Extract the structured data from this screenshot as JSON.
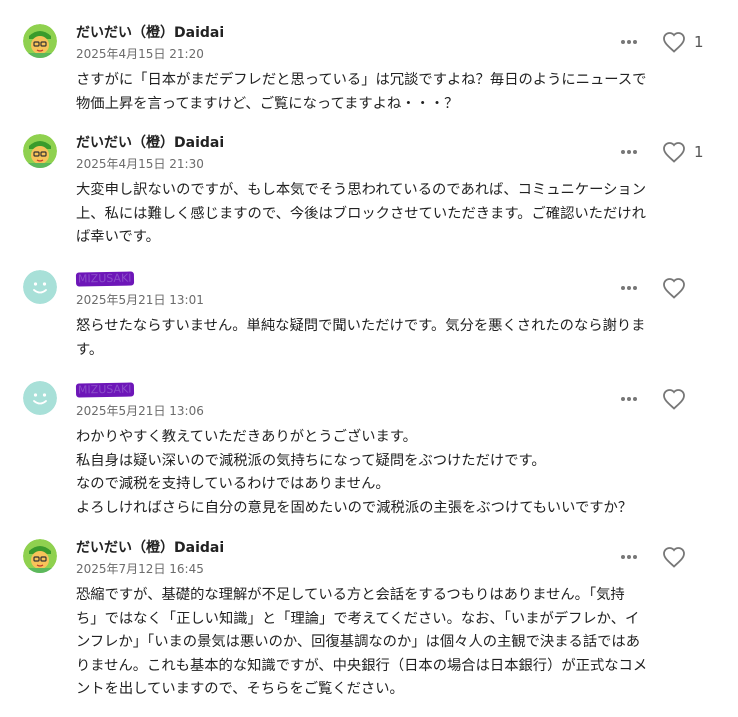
{
  "comments": [
    {
      "author": "だいだい（橙）Daidai",
      "avatar": "daidai-avatar",
      "redacted": false,
      "date": "2025年4月15日 21:20",
      "likes": "1",
      "lines": [
        "さすがに「日本がまだデフレだと思っている」は冗談ですよね？毎日のようにニュースで",
        "物価上昇を言ってますけど、ご覧になってますよね・・・？"
      ]
    },
    {
      "author": "だいだい（橙）Daidai",
      "avatar": "daidai-avatar",
      "redacted": false,
      "date": "2025年4月15日 21:30",
      "likes": "1",
      "lines": [
        "大変申し訳ないのですが、もし本気でそう思われているのであれば、コミュニケーション",
        "上、私には難しく感じますので、今後はブロックさせていただきます。ご確認いただけれ",
        "ば幸いです。"
      ]
    },
    {
      "author": "MIZUSAKI",
      "avatar": "default-avatar",
      "redacted": true,
      "date": "2025年5月21日 13:01",
      "likes": "",
      "lines": [
        "怒らせたならすいません。単純な疑問で聞いただけです。気分を悪くされたのなら謝りま",
        "す。"
      ]
    },
    {
      "author": "MIZUSAKI",
      "avatar": "default-avatar",
      "redacted": true,
      "date": "2025年5月21日 13:06",
      "likes": "",
      "lines": [
        "わかりやすく教えていただきありがとうございます。",
        "私自身は疑い深いので減税派の気持ちになって疑問をぶつけただけです。",
        "なので減税を支持しているわけではありません。",
        "よろしければさらに自分の意見を固めたいので減税派の主張をぶつけてもいいですか？"
      ]
    },
    {
      "author": "だいだい（橙）Daidai",
      "avatar": "daidai-avatar",
      "redacted": false,
      "date": "2025年7月12日 16:45",
      "likes": "",
      "lines": [
        "恐縮ですが、基礎的な理解が不足している方と会話をするつもりはありません。「気持",
        "ち」ではなく「正しい知識」と「理論」で考えてください。なお、「いまがデフレか、イ",
        "ンフレか」「いまの景気は悪いのか、回復基調なのか」は個々人の主観で決まる話ではあ",
        "りません。これも基本的な知識ですが、中央銀行（日本の場合は日本銀行）が正式なコメ",
        "ントを出していますので、そちらをご覧ください。"
      ]
    }
  ],
  "colors": {
    "text": "#222222",
    "date": "#6b6b6b",
    "icon": "#777777",
    "redaction": "#6d16b8",
    "default_avatar": "#a8e0d8",
    "daidai_avatar_bg": "#8fd14f"
  }
}
